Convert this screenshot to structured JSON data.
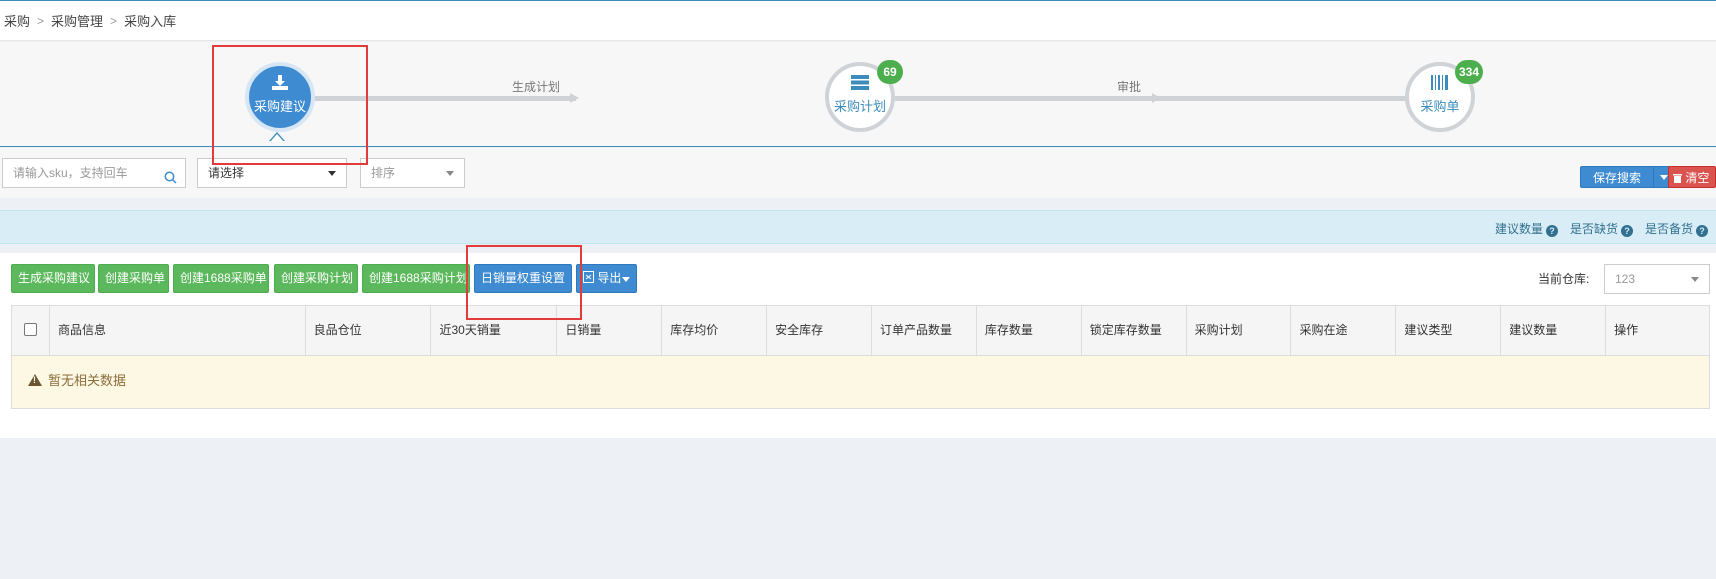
{
  "breadcrumb": [
    "采购",
    "采购管理",
    "采购入库"
  ],
  "steps": [
    {
      "label": "采购建议",
      "badge": ""
    },
    {
      "label": "采购计划",
      "badge": "69"
    },
    {
      "label": "采购单",
      "badge": "334"
    }
  ],
  "track_labels": [
    "生成计划",
    "审批"
  ],
  "filters": {
    "sku_placeholder": "请输入sku，支持回车",
    "select_value": "请选择",
    "sort_value": "排序"
  },
  "search_actions": {
    "save": "保存搜索",
    "clear": "清空"
  },
  "info_links": [
    "建议数量",
    "是否缺货",
    "是否备货"
  ],
  "toolbar": {
    "buttons": [
      "生成采购建议",
      "创建采购单",
      "创建1688采购单",
      "创建采购计划",
      "创建1688采购计划",
      "日销量权重设置",
      "导出"
    ],
    "warehouse_label": "当前仓库:",
    "warehouse_value": "123"
  },
  "table": {
    "columns": [
      "商品信息",
      "良品仓位",
      "近30天销量",
      "日销量",
      "库存均价",
      "安全库存",
      "订单产品数量",
      "库存数量",
      "锁定库存数量",
      "采购计划",
      "采购在途",
      "建议类型",
      "建议数量",
      "操作"
    ],
    "empty_text": "暂无相关数据"
  },
  "colors": {
    "primary": "#3e8bd2",
    "success": "#5cb85c",
    "danger": "#d9534f",
    "highlight": "#e23b3b"
  }
}
